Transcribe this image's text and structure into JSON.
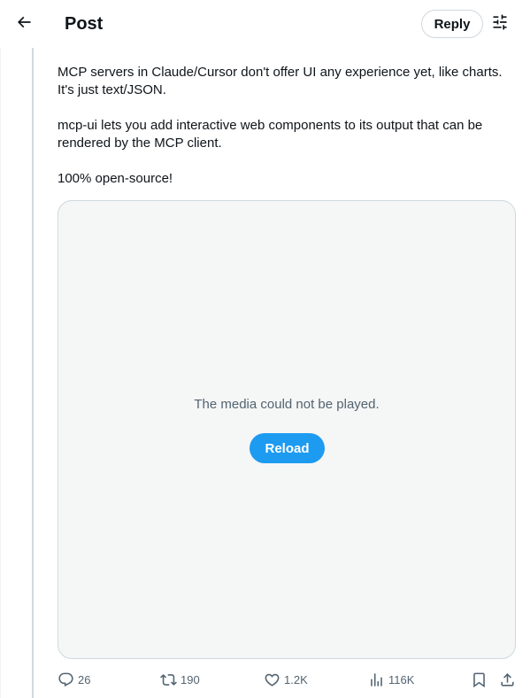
{
  "header": {
    "title": "Post",
    "reply_label": "Reply",
    "icons": {
      "back": "arrow-left-icon",
      "filter": "sliders-icon"
    }
  },
  "post": {
    "paragraphs": [
      "MCP servers in Claude/Cursor don't offer UI any experience yet, like charts. It's just text/JSON.",
      "mcp-ui lets you add interactive web components to its output that can be rendered by the MCP client.",
      "100% open-source!"
    ]
  },
  "media": {
    "message": "The media could not be played.",
    "reload_label": "Reload"
  },
  "actions": {
    "replies": "26",
    "reposts": "190",
    "likes": "1.2K",
    "views": "116K",
    "icons": [
      "reply-icon",
      "repost-icon",
      "like-icon",
      "views-icon",
      "bookmark-icon",
      "share-icon"
    ]
  },
  "colors": {
    "accent": "#1d9bf0",
    "text": "#0f1419",
    "muted": "#536471",
    "border": "#cfd9de",
    "media_bg": "#f5f6f6"
  }
}
